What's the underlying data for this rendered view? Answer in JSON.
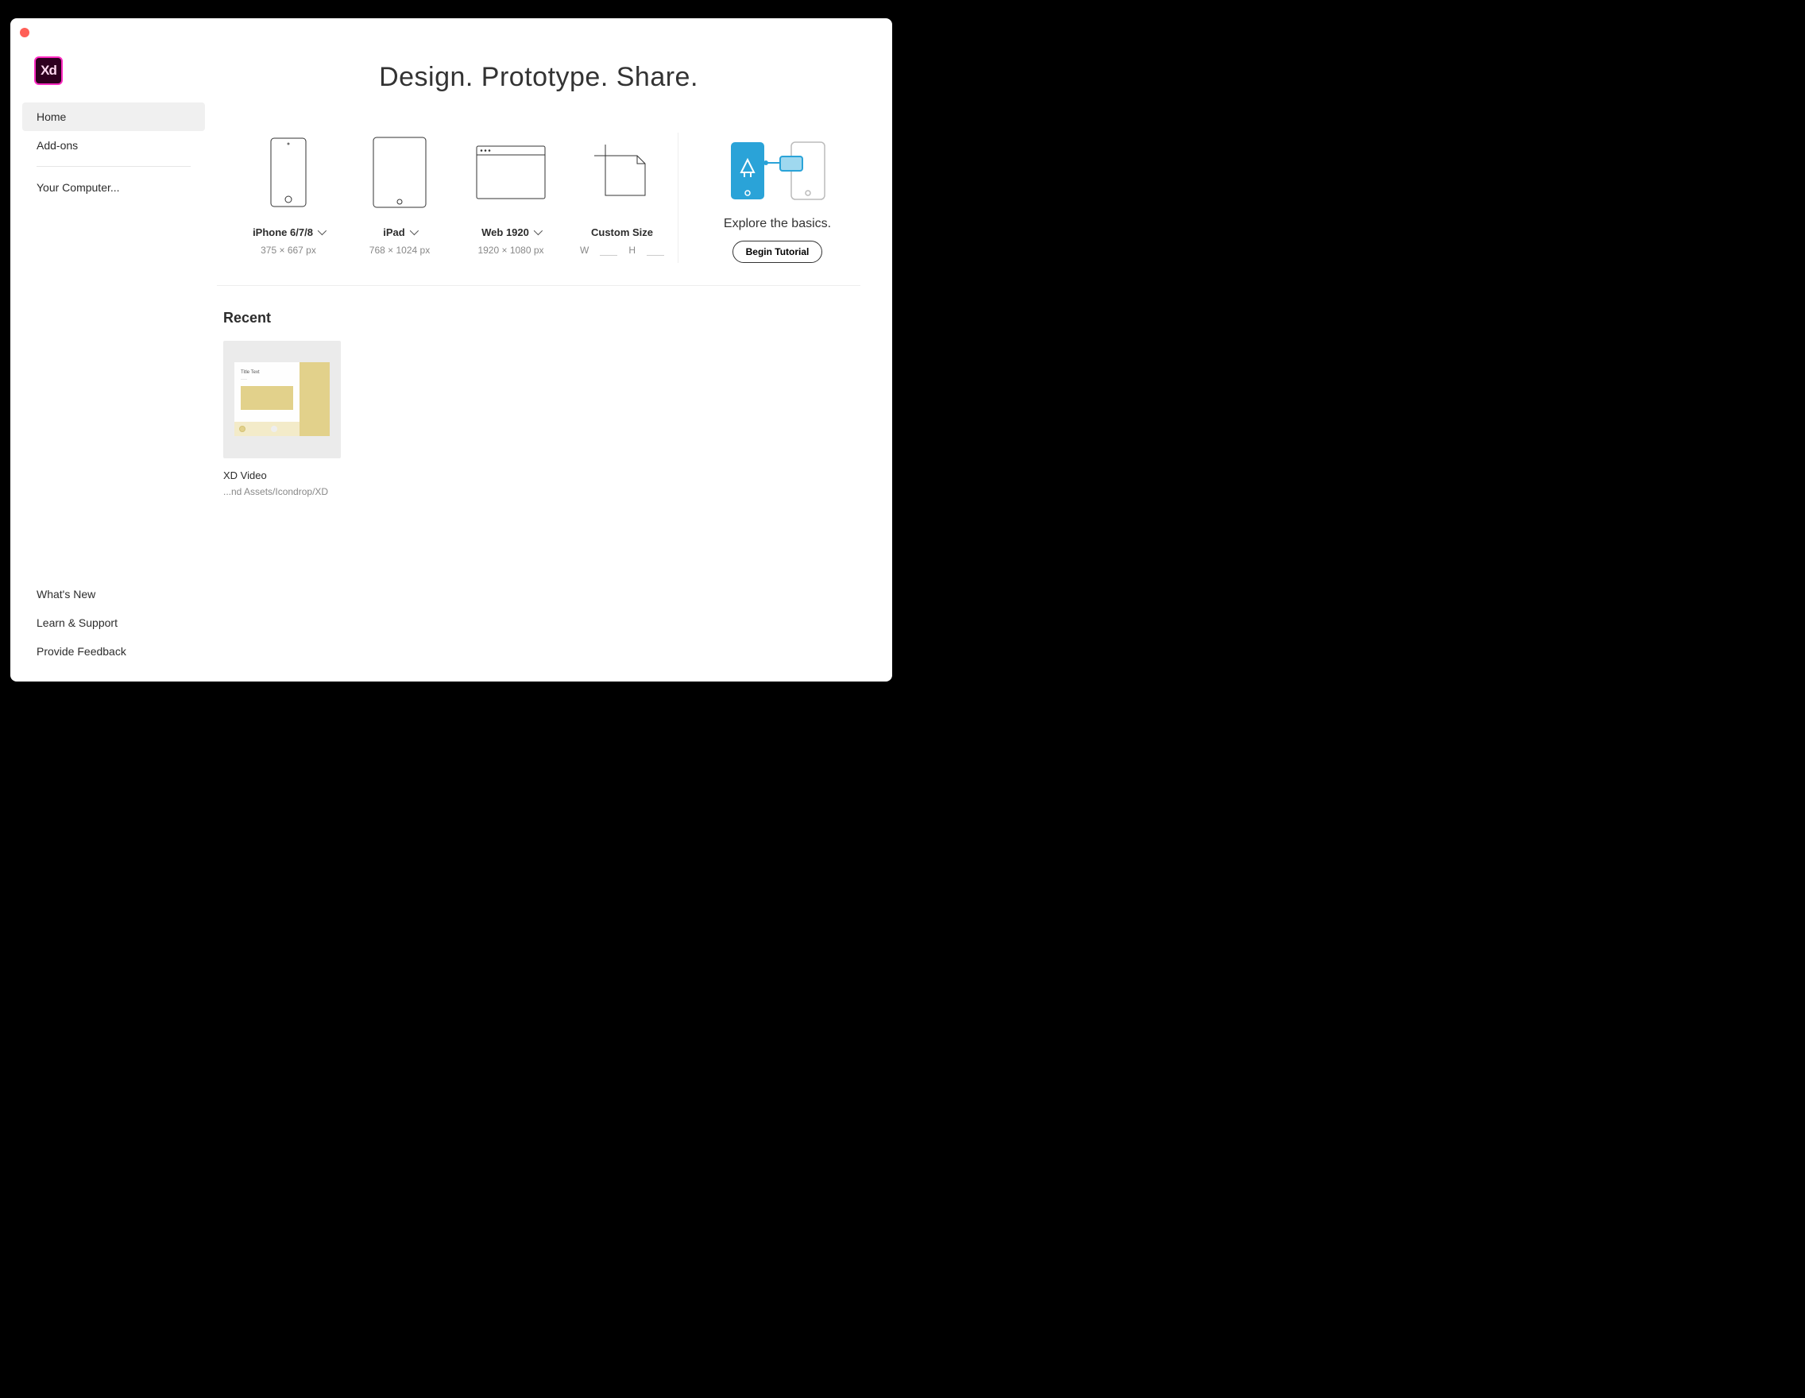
{
  "app": {
    "logo": "Xd"
  },
  "hero": {
    "title": "Design. Prototype. Share."
  },
  "sidebar": {
    "items": [
      {
        "label": "Home",
        "active": true
      },
      {
        "label": "Add-ons",
        "active": false
      }
    ],
    "secondary": [
      {
        "label": "Your Computer..."
      }
    ],
    "bottom": [
      {
        "label": "What's New"
      },
      {
        "label": "Learn & Support"
      },
      {
        "label": "Provide Feedback"
      }
    ]
  },
  "templates": [
    {
      "name": "iPhone 6/7/8",
      "dimensions": "375 × 667 px",
      "has_dropdown": true
    },
    {
      "name": "iPad",
      "dimensions": "768 × 1024 px",
      "has_dropdown": true
    },
    {
      "name": "Web 1920",
      "dimensions": "1920 × 1080 px",
      "has_dropdown": true
    },
    {
      "name": "Custom Size",
      "width_label": "W",
      "height_label": "H",
      "has_dropdown": false
    }
  ],
  "tutorial": {
    "title": "Explore the basics.",
    "button": "Begin Tutorial"
  },
  "recent": {
    "title": "Recent",
    "items": [
      {
        "name": "XD Video",
        "path": "...nd Assets/Icondrop/XD",
        "thumb_title": "Title Text"
      }
    ]
  }
}
